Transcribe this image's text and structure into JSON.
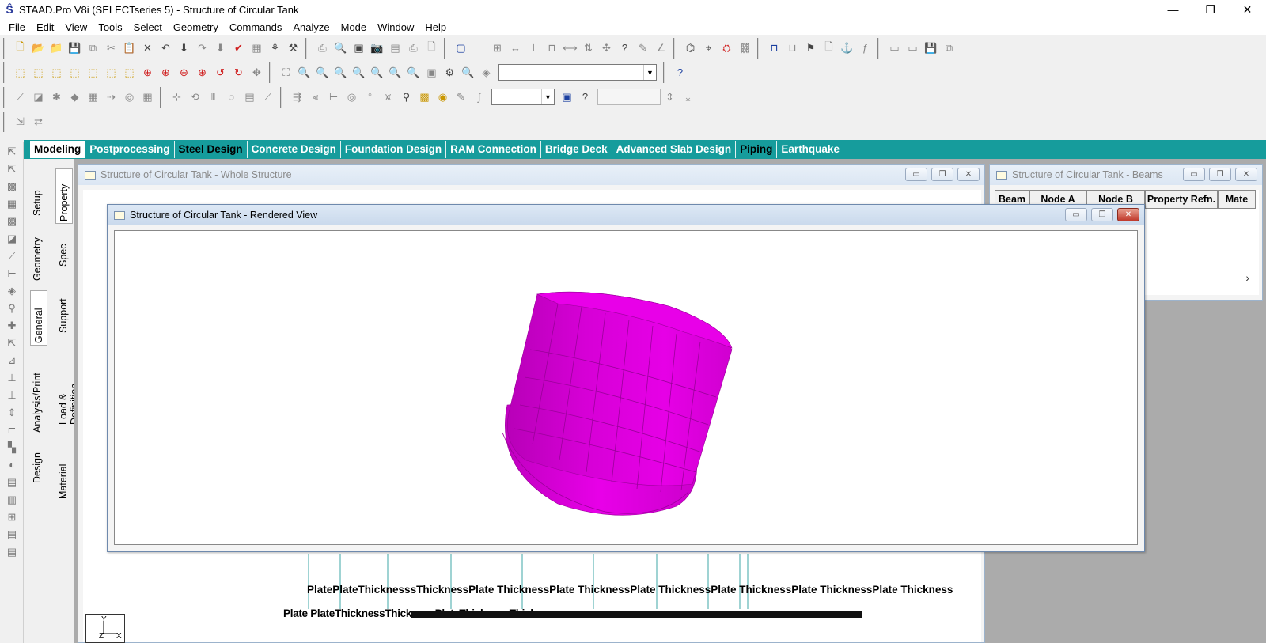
{
  "window": {
    "title": "STAAD.Pro V8i (SELECTseries 5) - Structure of Circular Tank",
    "minimize": "—",
    "maximize": "❐",
    "close": "✕"
  },
  "menu": [
    "File",
    "Edit",
    "View",
    "Tools",
    "Select",
    "Geometry",
    "Commands",
    "Analyze",
    "Mode",
    "Window",
    "Help"
  ],
  "page_tabs": [
    {
      "label": "Modeling",
      "active": true
    },
    {
      "label": "Postprocessing"
    },
    {
      "label": "Steel Design",
      "dark": true
    },
    {
      "label": "Concrete Design"
    },
    {
      "label": "Foundation Design"
    },
    {
      "label": "RAM Connection"
    },
    {
      "label": "Bridge Deck"
    },
    {
      "label": "Advanced Slab Design"
    },
    {
      "label": "Piping",
      "dark": true
    },
    {
      "label": "Earthquake"
    }
  ],
  "vertical_tabs_outer": [
    "Setup",
    "Geometry",
    "General",
    "Analysis/Print",
    "Design"
  ],
  "vertical_tabs_inner": [
    "Property",
    "Spec",
    "Support",
    "Load & Definition",
    "Material"
  ],
  "windows": {
    "whole": {
      "title": "Structure of Circular Tank - Whole Structure"
    },
    "beams": {
      "title": "Structure of Circular Tank - Beams",
      "columns": [
        "Beam",
        "Node A",
        "Node B",
        "Property Refn.",
        "Mate"
      ]
    },
    "rendered": {
      "title": "Structure of Circular Tank - Rendered View"
    }
  },
  "plate_labels": {
    "row1": "PlatePlateThicknesssThicknessPlate ThicknessPlate ThicknessPlate ThicknessPlate ThicknessPlate ThicknessPlate Thickness",
    "row2": "Plate PlateThicknessThicknessPlateThicknessThickness"
  },
  "axis": {
    "y": "Y",
    "z": "Z",
    "x": "X"
  },
  "colors": {
    "tab_bar": "#169c9c",
    "tank": "#e000e0",
    "mdi_bg": "#ababab"
  }
}
